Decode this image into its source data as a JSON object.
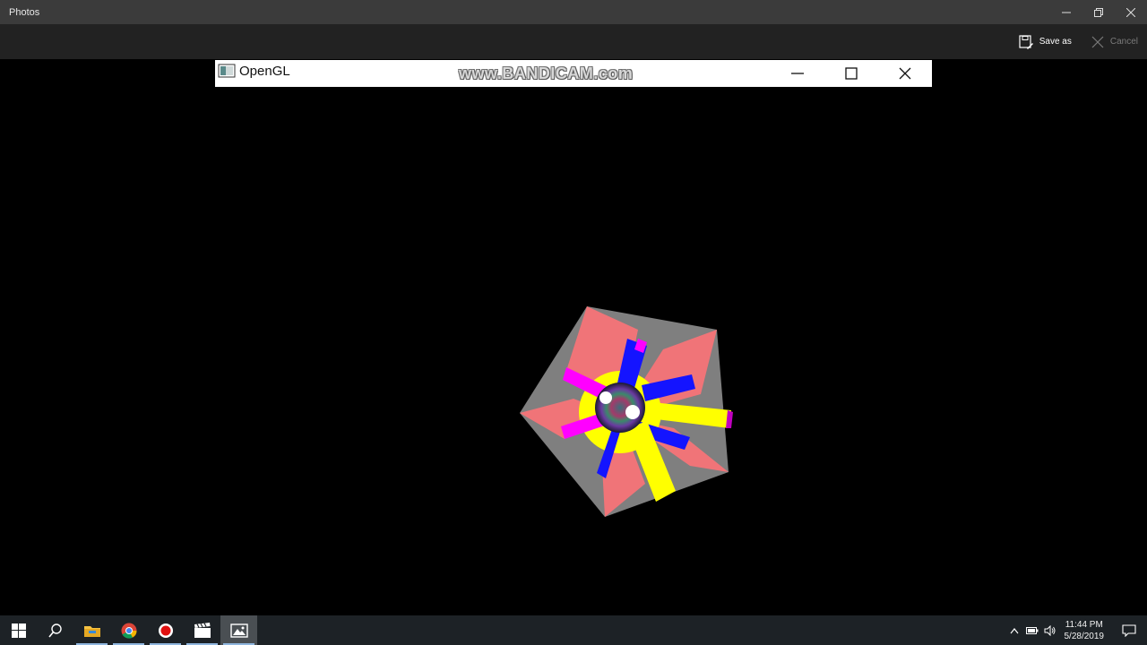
{
  "app": {
    "title": "Photos"
  },
  "toolbar": {
    "save_label": "Save as",
    "cancel_label": "Cancel"
  },
  "gl_window": {
    "title": "OpenGL",
    "watermark": "www.BANDICAM.com"
  },
  "taskbar": {
    "apps": [
      "start-icon",
      "search-icon",
      "file-explorer-icon",
      "chrome-icon",
      "record-icon",
      "clapper-icon",
      "photos-icon"
    ],
    "clock": {
      "time": "11:44 PM",
      "date": "5/28/2019"
    }
  },
  "colors": {
    "gray": "#7f7f7f",
    "salmon": "#f07478",
    "yellow": "#ffff00",
    "blue": "#1414ff",
    "magenta": "#ff00ff",
    "accent": "#8fb6de"
  }
}
